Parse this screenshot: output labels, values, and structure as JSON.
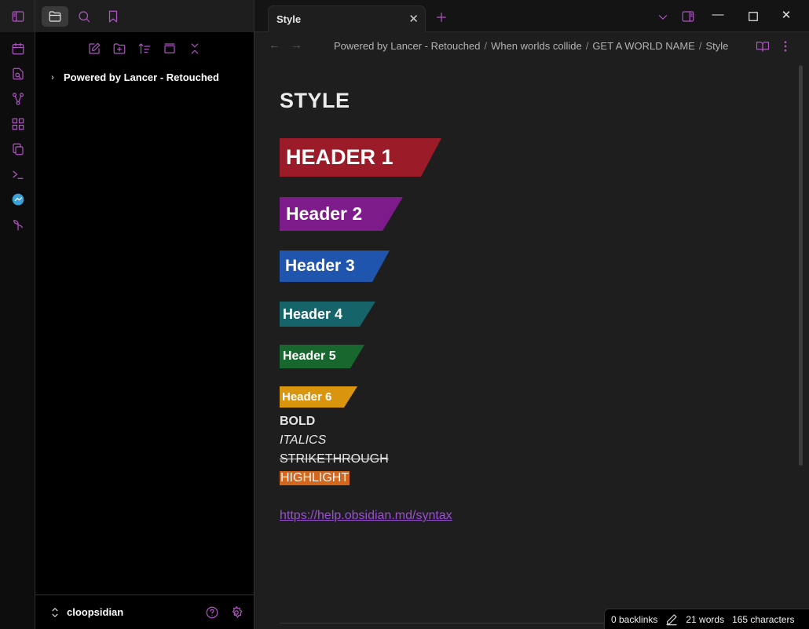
{
  "colors": {
    "accent": "#b056c4",
    "header1": "#9b1b28",
    "header2": "#7e1b8b",
    "header3": "#1f55ad",
    "header4": "#15646a",
    "header5": "#18672f",
    "header6": "#d9950d",
    "highlight": "#d4671b",
    "link": "#9a4fd3"
  },
  "ribbon": {
    "icons": [
      "calendar-icon",
      "file-search-icon",
      "graph-icon",
      "grid-icon",
      "copy-icon",
      "terminal-icon",
      "globe-icon",
      "sprout-icon"
    ]
  },
  "sidebar": {
    "tree": [
      {
        "label": "Powered by Lancer - Retouched"
      }
    ],
    "vault_name": "cloopsidian"
  },
  "tabs": [
    {
      "title": "Style",
      "active": true
    }
  ],
  "breadcrumb": [
    "Powered by Lancer - Retouched",
    "When worlds collide",
    "GET A WORLD NAME",
    "Style"
  ],
  "document": {
    "title": "STYLE",
    "headers": [
      "HEADER 1",
      "Header 2",
      "Header 3",
      "Header 4",
      "Header 5",
      "Header 6"
    ],
    "bold": "BOLD",
    "italics": "ITALICS",
    "strikethrough": "STRIKETHROUGH",
    "highlight": "HIGHLIGHT",
    "link": "https://help.obsidian.md/syntax"
  },
  "status": {
    "backlinks": "0 backlinks",
    "words": "21 words",
    "characters": "165 characters"
  }
}
